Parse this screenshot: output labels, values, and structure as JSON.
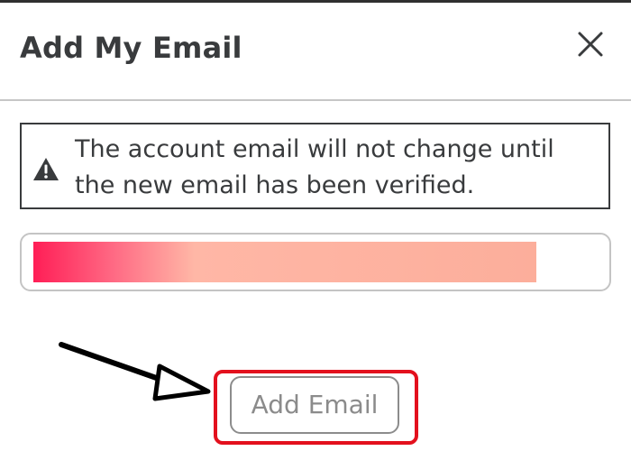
{
  "dialog": {
    "title": "Add My Email",
    "close_icon": "close-icon",
    "warning": {
      "icon": "warning-icon",
      "text": "The account email will not change until\nthe new email has been verified."
    },
    "email_input": {
      "value": ""
    },
    "add_button_label": "Add Email"
  },
  "annotation": {
    "highlight_color": "#e3101d",
    "arrow_color": "#000000"
  }
}
